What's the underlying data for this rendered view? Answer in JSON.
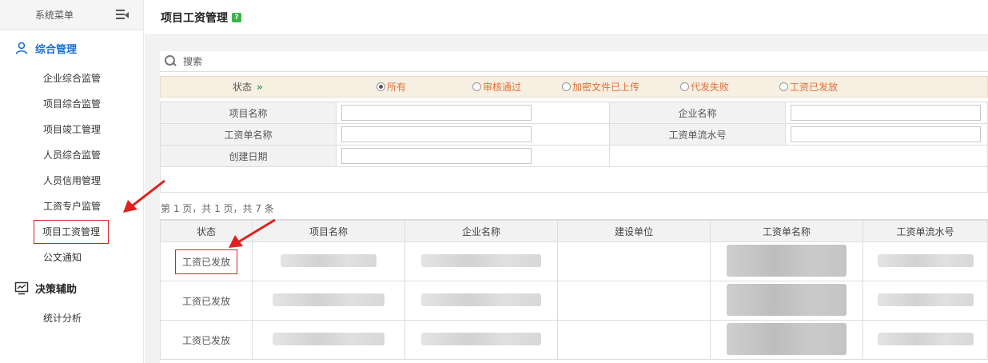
{
  "sidebar": {
    "header": "系统菜单",
    "group1": "综合管理",
    "items": [
      "企业综合监管",
      "项目综合监管",
      "项目竣工管理",
      "人员综合监管",
      "人员信用管理",
      "工资专户监管",
      "项目工资管理",
      "公文通知"
    ],
    "group2": "决策辅助",
    "items2": [
      "统计分析"
    ]
  },
  "page": {
    "title": "项目工资管理",
    "help": "?"
  },
  "search": {
    "label": "搜索"
  },
  "status_filter": {
    "label": "状态",
    "options": [
      "所有",
      "审核通过",
      "加密文件已上传",
      "代发失败",
      "工资已发放"
    ],
    "selected": "所有"
  },
  "form": {
    "project_name": "项目名称",
    "company_name": "企业名称",
    "payroll_name": "工资单名称",
    "payroll_serial": "工资单流水号",
    "created_date": "创建日期"
  },
  "paging": "第 1 页，共 1 页，共 7 条",
  "grid": {
    "columns": [
      "状态",
      "项目名称",
      "企业名称",
      "建设单位",
      "工资单名称",
      "工资单流水号"
    ],
    "rows": [
      {
        "status": "工资已发放"
      },
      {
        "status": "工资已发放"
      },
      {
        "status": "工资已发放"
      }
    ]
  },
  "colors": {
    "accent": "#1a6fd2",
    "annotation": "#e02020",
    "status_option": "#e0703a"
  }
}
